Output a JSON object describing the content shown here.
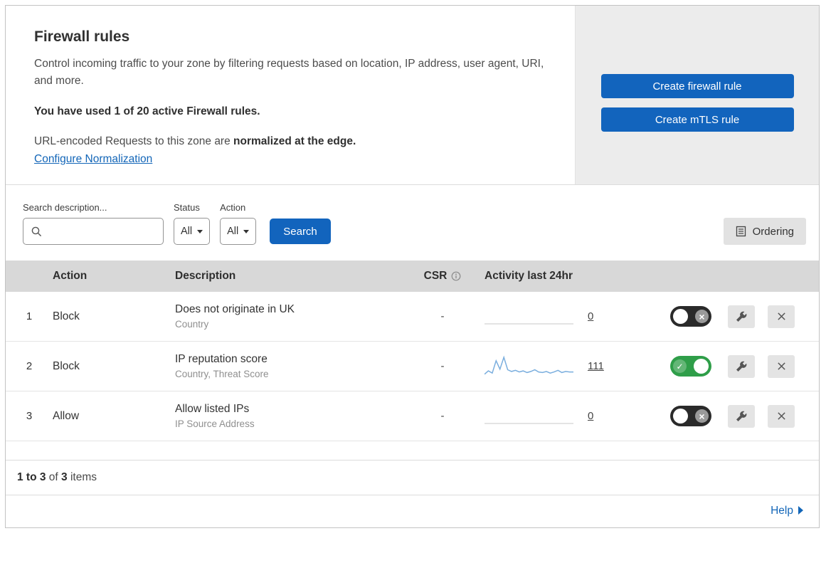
{
  "header": {
    "title": "Firewall rules",
    "description": "Control incoming traffic to your zone by filtering requests based on location, IP address, user agent, URI, and more.",
    "usage_note": "You have used 1 of 20 active Firewall rules.",
    "normalization_prefix": "URL-encoded Requests to this zone are ",
    "normalization_bold": "normalized at the edge.",
    "configure_link": "Configure Normalization",
    "create_firewall_button": "Create firewall rule",
    "create_mtls_button": "Create mTLS rule"
  },
  "filters": {
    "search_label": "Search description...",
    "status_label": "Status",
    "status_value": "All",
    "action_label": "Action",
    "action_value": "All",
    "search_button": "Search",
    "ordering_button": "Ordering"
  },
  "table": {
    "headers": {
      "action": "Action",
      "description": "Description",
      "csr": "CSR",
      "activity": "Activity last 24hr"
    },
    "rows": [
      {
        "num": "1",
        "action": "Block",
        "description": "Does not originate in UK",
        "criteria": "Country",
        "csr": "-",
        "activity_count": "0",
        "enabled": false
      },
      {
        "num": "2",
        "action": "Block",
        "description": "IP reputation score",
        "criteria": "Country, Threat Score",
        "csr": "-",
        "activity_count": "111",
        "enabled": true,
        "sparkline": [
          4,
          10,
          6,
          28,
          13,
          34,
          12,
          9,
          11,
          8,
          10,
          7,
          9,
          12,
          8,
          7,
          9,
          6,
          8,
          11,
          7,
          9,
          8,
          8
        ]
      },
      {
        "num": "3",
        "action": "Allow",
        "description": "Allow listed IPs",
        "criteria": "IP Source Address",
        "csr": "-",
        "activity_count": "0",
        "enabled": false
      }
    ]
  },
  "footer": {
    "range_bold": "1 to 3",
    "of_text": " of ",
    "total_bold": "3",
    "items_text": " items",
    "help_label": "Help"
  },
  "colors": {
    "accent_blue": "#1264bd",
    "link_blue": "#1366b8",
    "toggle_on_green": "#2f9e49",
    "toggle_off_dark": "#2a2a2a",
    "table_header_gray": "#d8d8d8",
    "side_panel_gray": "#ececec",
    "sparkline_blue": "#7aaede"
  }
}
